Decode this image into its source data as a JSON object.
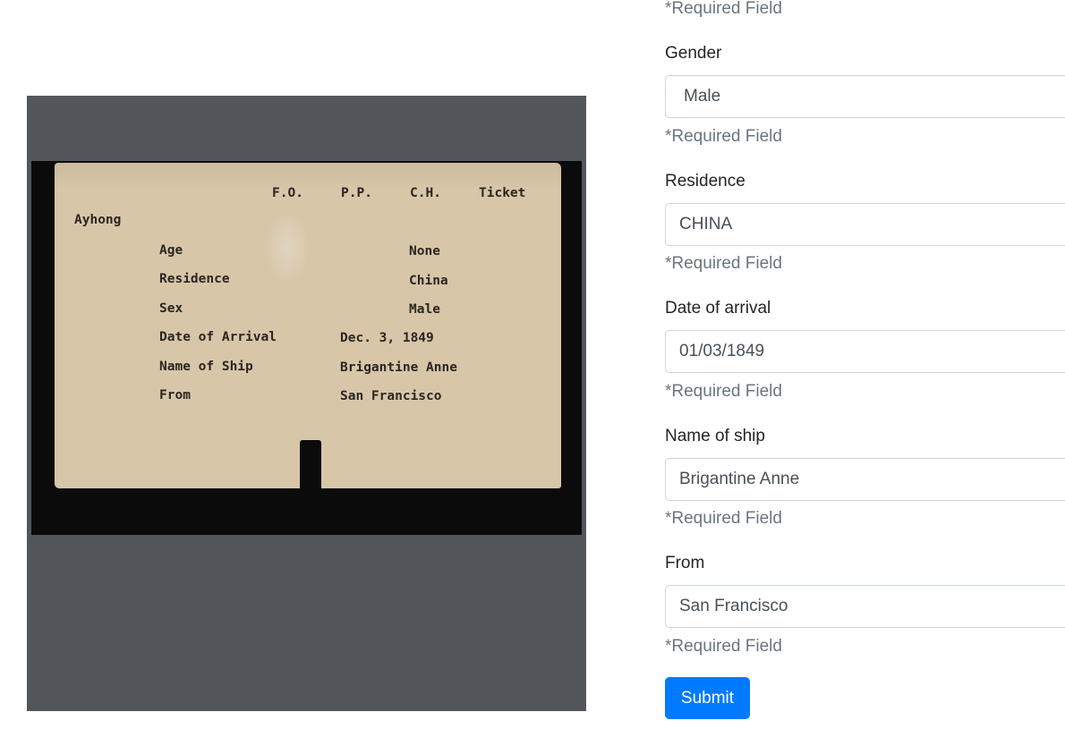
{
  "card": {
    "header": {
      "fo": "F.O.",
      "pp": "P.P.",
      "ch": "C.H.",
      "ticket": "Ticket"
    },
    "name": "Ayhong",
    "rows": [
      {
        "label": "Age",
        "value": "None"
      },
      {
        "label": "Residence",
        "value": "China"
      },
      {
        "label": "Sex",
        "value": "Male"
      },
      {
        "label": "Date of Arrival",
        "value": "Dec. 3, 1849"
      },
      {
        "label": "Name of Ship",
        "value": "Brigantine Anne"
      },
      {
        "label": "From",
        "value": "San Francisco"
      }
    ]
  },
  "form": {
    "top_help": "*Required Field",
    "fields": [
      {
        "label": "Gender",
        "value": "Male",
        "help": "*Required Field"
      },
      {
        "label": "Residence",
        "value": "CHINA",
        "help": "*Required Field"
      },
      {
        "label": "Date of arrival",
        "value": "01/03/1849",
        "help": "*Required Field"
      },
      {
        "label": "Name of ship",
        "value": "Brigantine Anne",
        "help": "*Required Field"
      },
      {
        "label": "From",
        "value": "San Francisco",
        "help": "*Required Field"
      }
    ],
    "submit_label": "Submit"
  },
  "colors": {
    "primary": "#007bff",
    "viewer_bg": "#53575b",
    "card_bg": "#d8c6a8",
    "help_text": "#6c757d"
  }
}
